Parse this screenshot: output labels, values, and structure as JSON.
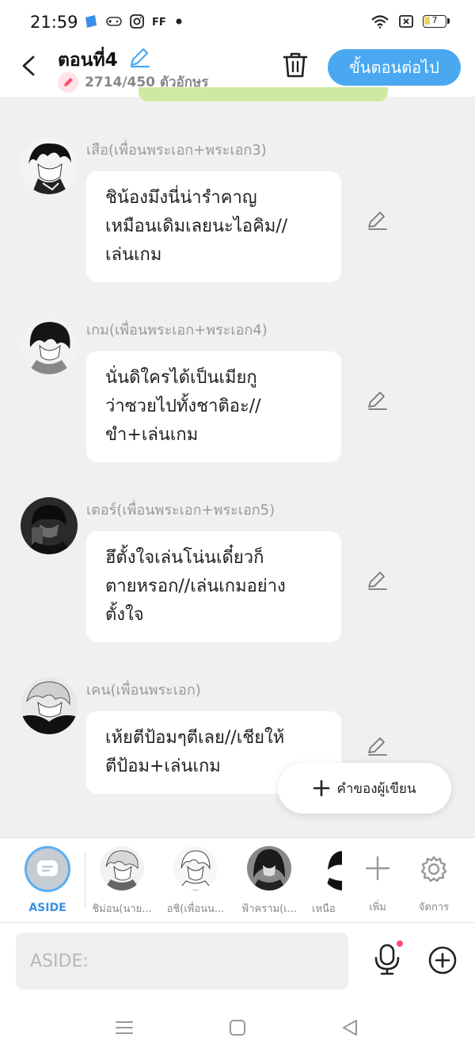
{
  "status_bar": {
    "time": "21:59",
    "battery": "7"
  },
  "header": {
    "title": "ตอนที่4",
    "char_count": "2714/450 ตัวอักษร",
    "next_button": "ขั้นตอนต่อไป"
  },
  "messages": [
    {
      "name": "เสือ(เพื่อนพระเอก+พระเอก3)",
      "lines": [
        "ชิน้องมึงนี่น่ารำคาญ",
        "เหมือนเดิมเลยนะไอคิม//",
        "เล่นเกม"
      ]
    },
    {
      "name": "เกม(เพื่อนพระเอก+พระเอก4)",
      "lines": [
        "นั่นดิใครได้เป็นเมียกู",
        "ว่าซวยไปทั้งชาติอะ//",
        "ขำ+เล่นเกม"
      ]
    },
    {
      "name": "เตอร์(เพื่อนพระเอก+พระเอก5)",
      "lines": [
        "ฮึตั้งใจเล่นโน่นเดี๋ยวก็",
        "ตายหรอก//เล่นเกมอย่าง",
        "ตั้งใจ"
      ]
    },
    {
      "name": "เคน(เพื่อนพระเอก)",
      "lines": [
        "เห้ยตีป้อมๆตีเลย//เชียให้",
        "ตีป้อม+เล่นเกม"
      ]
    }
  ],
  "writer_note_button": "คำของผู้เขียน",
  "characters": {
    "aside": "ASIDE",
    "list": [
      "ชิม่อน(นาย...",
      "อชิ(เพื่อนน...",
      "ฟ้าคราม(เ...",
      "เหนือ"
    ],
    "add": "เพิ่ม",
    "manage": "จัดการ"
  },
  "input": {
    "placeholder": "ASIDE:"
  },
  "colors": {
    "accent": "#4aa8f0",
    "badge": "#ff4d6d"
  }
}
